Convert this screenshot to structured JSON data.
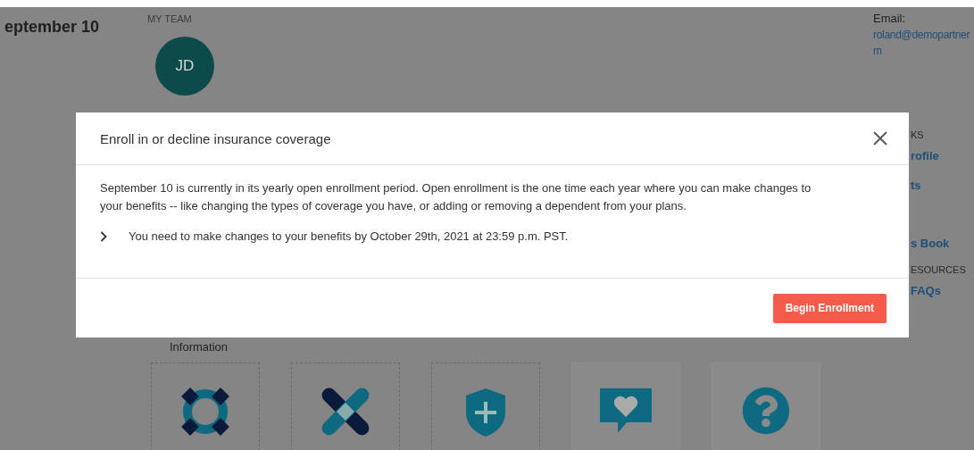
{
  "page": {
    "title": "eptember 10",
    "team": {
      "heading": "MY TEAM",
      "avatar": "JD"
    },
    "contact": {
      "label": "Email:",
      "email_lines": [
        "roland@demopartner",
        "m"
      ]
    },
    "side_links": [
      {
        "text": "KS",
        "kind": "heading"
      },
      {
        "text": "rofile",
        "kind": "link"
      },
      {
        "text": "ts",
        "kind": "link"
      },
      {
        "text": "s Book",
        "kind": "link"
      },
      {
        "text": "ESOURCES",
        "kind": "heading"
      },
      {
        "text": "FAQs",
        "kind": "link"
      }
    ],
    "section_label": "Information",
    "tiles": [
      {
        "kind": "lifebuoy",
        "dashed": true
      },
      {
        "kind": "bandage",
        "dashed": true
      },
      {
        "kind": "shield",
        "dashed": true
      },
      {
        "kind": "heart-chat",
        "dashed": false
      },
      {
        "kind": "question",
        "dashed": false
      }
    ]
  },
  "modal": {
    "title": "Enroll in or decline insurance coverage",
    "body": "September 10 is currently in its yearly open enrollment period. Open enrollment is the one time each year where you can make changes to your benefits -- like changing the types of coverage you have, or adding or removing a dependent from your plans.",
    "notice": "You need to make changes to your benefits by October 29th, 2021 at 23:59 p.m. PST.",
    "button": "Begin Enrollment"
  }
}
